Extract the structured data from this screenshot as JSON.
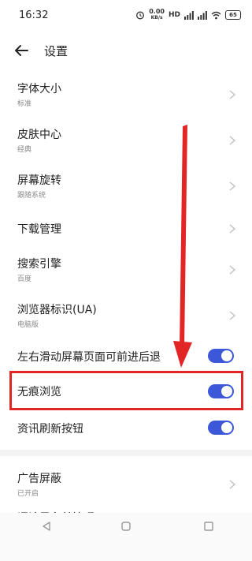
{
  "status_bar": {
    "time": "16:32",
    "speed_value": "0.00",
    "speed_unit": "KB/s",
    "network_label": "HD",
    "battery_level": "65",
    "icons": [
      "alarm-icon",
      "speed-icon",
      "hd-icon",
      "signal-icon",
      "signal-icon",
      "wifi-icon",
      "battery-icon"
    ]
  },
  "toolbar": {
    "back_icon": "arrow-left-icon",
    "title": "设置"
  },
  "settings": {
    "font_size": {
      "label": "字体大小",
      "value": "标准"
    },
    "skin_center": {
      "label": "皮肤中心",
      "value": "经典"
    },
    "screen_rotation": {
      "label": "屏幕旋转",
      "value": "跟随系统"
    },
    "download_manager": {
      "label": "下载管理"
    },
    "search_engine": {
      "label": "搜索引擎",
      "value": "百度"
    },
    "browser_ua": {
      "label": "浏览器标识(UA)",
      "value": "电脑版"
    },
    "swipe_navigation": {
      "label": "左右滑动屏幕页面可前进后退",
      "enabled": true
    },
    "incognito": {
      "label": "无痕浏览",
      "enabled": true
    },
    "news_refresh": {
      "label": "资讯刷新按钮",
      "enabled": true
    },
    "ad_block": {
      "label": "广告屏蔽",
      "value": "已开启"
    },
    "comment_blacklist": {
      "label": "评论黑名单管理"
    }
  },
  "annotation": {
    "highlight_color": "#e22525",
    "arrow_color": "#e22525"
  },
  "nav_bar": {
    "buttons": [
      "back-triangle-icon",
      "home-square-icon",
      "recents-square-icon"
    ]
  },
  "colors": {
    "toggle_on": "#3d57d9",
    "secondary_text": "#8a8a8a"
  }
}
